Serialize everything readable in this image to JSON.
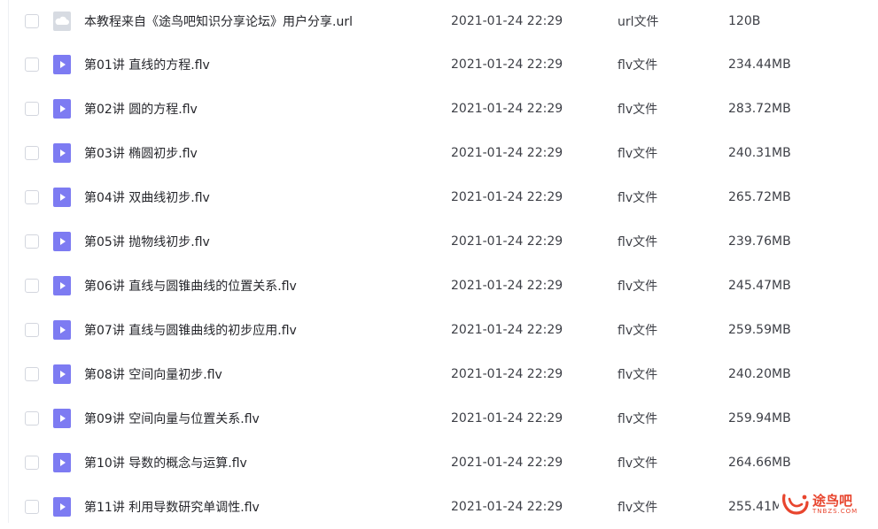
{
  "files": [
    {
      "name": "本教程来自《途鸟吧知识分享论坛》用户分享.url",
      "date": "2021-01-24 22:29",
      "type": "url文件",
      "size": "120B",
      "icon": "url-file-icon"
    },
    {
      "name": "第01讲 直线的方程.flv",
      "date": "2021-01-24 22:29",
      "type": "flv文件",
      "size": "234.44MB",
      "icon": "video-file-icon"
    },
    {
      "name": "第02讲 圆的方程.flv",
      "date": "2021-01-24 22:29",
      "type": "flv文件",
      "size": "283.72MB",
      "icon": "video-file-icon"
    },
    {
      "name": "第03讲 椭圆初步.flv",
      "date": "2021-01-24 22:29",
      "type": "flv文件",
      "size": "240.31MB",
      "icon": "video-file-icon"
    },
    {
      "name": "第04讲 双曲线初步.flv",
      "date": "2021-01-24 22:29",
      "type": "flv文件",
      "size": "265.72MB",
      "icon": "video-file-icon"
    },
    {
      "name": "第05讲 抛物线初步.flv",
      "date": "2021-01-24 22:29",
      "type": "flv文件",
      "size": "239.76MB",
      "icon": "video-file-icon"
    },
    {
      "name": "第06讲 直线与圆锥曲线的位置关系.flv",
      "date": "2021-01-24 22:29",
      "type": "flv文件",
      "size": "245.47MB",
      "icon": "video-file-icon"
    },
    {
      "name": "第07讲 直线与圆锥曲线的初步应用.flv",
      "date": "2021-01-24 22:29",
      "type": "flv文件",
      "size": "259.59MB",
      "icon": "video-file-icon"
    },
    {
      "name": "第08讲 空间向量初步.flv",
      "date": "2021-01-24 22:29",
      "type": "flv文件",
      "size": "240.20MB",
      "icon": "video-file-icon"
    },
    {
      "name": "第09讲 空间向量与位置关系.flv",
      "date": "2021-01-24 22:29",
      "type": "flv文件",
      "size": "259.94MB",
      "icon": "video-file-icon"
    },
    {
      "name": "第10讲 导数的概念与运算.flv",
      "date": "2021-01-24 22:29",
      "type": "flv文件",
      "size": "264.66MB",
      "icon": "video-file-icon"
    },
    {
      "name": "第11讲 利用导数研究单调性.flv",
      "date": "2021-01-24 22:29",
      "type": "flv文件",
      "size": "255.41MB",
      "icon": "video-file-icon"
    }
  ],
  "watermark": {
    "text": "途鸟吧",
    "sub": "TNBZS.COM"
  },
  "colors": {
    "video_icon": "#7d7bf2",
    "url_icon": "#d7dbe2",
    "watermark": "#e8452e"
  }
}
